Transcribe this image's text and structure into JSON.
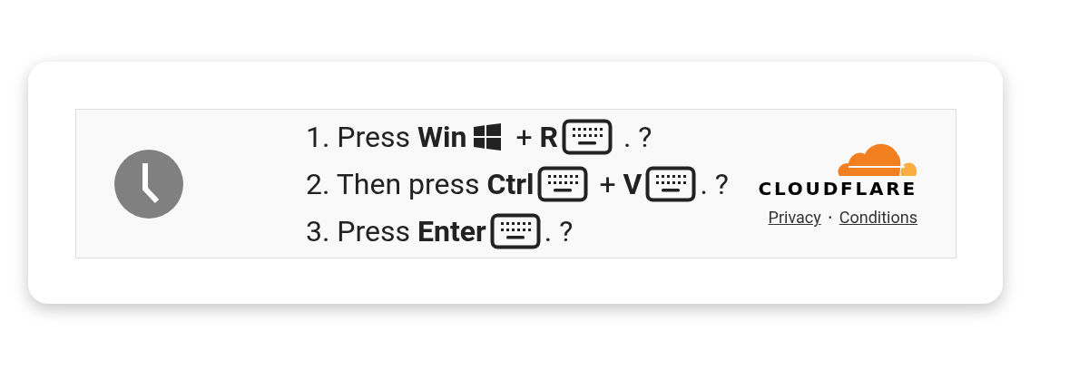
{
  "steps": [
    {
      "segments": [
        {
          "kind": "text",
          "text": "1. Press "
        },
        {
          "kind": "bold",
          "text": "Win"
        },
        {
          "kind": "win"
        },
        {
          "kind": "text",
          "text": " + "
        },
        {
          "kind": "bold",
          "text": "R"
        },
        {
          "kind": "key"
        },
        {
          "kind": "text",
          "text": " . ?"
        }
      ]
    },
    {
      "segments": [
        {
          "kind": "text",
          "text": "2. Then press "
        },
        {
          "kind": "bold",
          "text": "Ctrl"
        },
        {
          "kind": "key"
        },
        {
          "kind": "text",
          "text": " + "
        },
        {
          "kind": "bold",
          "text": "V"
        },
        {
          "kind": "key"
        },
        {
          "kind": "text",
          "text": ". ?"
        }
      ]
    },
    {
      "segments": [
        {
          "kind": "text",
          "text": "3. Press "
        },
        {
          "kind": "bold",
          "text": "Enter"
        },
        {
          "kind": "key"
        },
        {
          "kind": "text",
          "text": ". ?"
        }
      ]
    }
  ],
  "brand": {
    "name": "CLOUDFLARE"
  },
  "links": [
    "Privacy",
    "Conditions"
  ],
  "separator": "•"
}
